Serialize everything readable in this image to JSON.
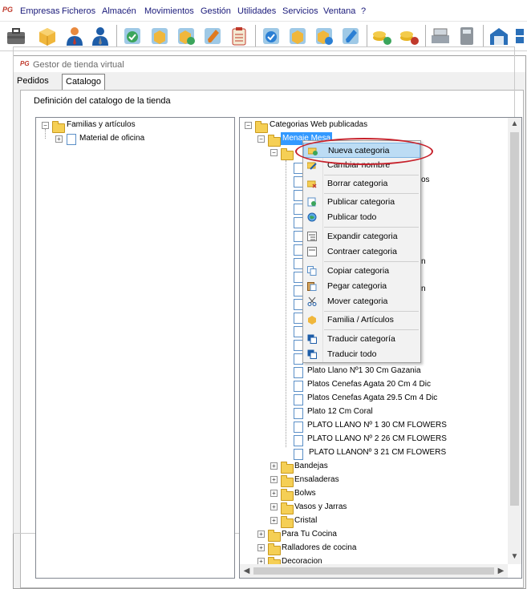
{
  "menubar": {
    "logo": "PG",
    "items": [
      "Empresas",
      "Ficheros",
      "Almacén",
      "Movimientos",
      "Gestión",
      "Utilidades",
      "Servicios",
      "Ventana",
      "?"
    ]
  },
  "toolbar": {
    "icons": [
      "briefcase-icon",
      "box-icon",
      "person-icon",
      "person-tie-icon",
      "check-icon",
      "box-yellow-icon",
      "box-check-icon",
      "pencil-icon",
      "clipboard-icon",
      "check-box-icon",
      "box-arrow-icon",
      "box-check2-icon",
      "pencil2-icon",
      "coins-add-icon",
      "coins-remove-icon",
      "cash-register-icon",
      "calculator-icon",
      "warehouse-icon",
      "grid-icon"
    ]
  },
  "window": {
    "logo": "PG",
    "title": "Gestor de tienda virtual",
    "tabs": [
      "Pedidos",
      "Catalogo"
    ],
    "active_tab": "Catalogo",
    "group_label": "Definición del catalogo de la tienda"
  },
  "left_tree": {
    "root": "Familias y artículos",
    "children": [
      "Material de oficina"
    ]
  },
  "right_tree": {
    "root": "Categorias Web publicadas",
    "selected": "Menaje Mesa",
    "partial_under_menu": [
      "os",
      "n",
      "n"
    ],
    "products": [
      "Plato Llano Nº1 30 Cm Gazania",
      "Platos Cenefas Agata 20 Cm 4 Dic",
      "Platos Cenefas Agata 29.5 Cm 4 Dic",
      "Plato 12 Cm Coral",
      "PLATO LLANO Nº 1 30 CM FLOWERS",
      "PLATO LLANO Nº 2 26 CM FLOWERS",
      "PLATO LLANONº 3 21 CM FLOWERS"
    ],
    "subcategories": [
      "Bandejas",
      "Ensaladeras",
      "Bolws",
      "Vasos y Jarras",
      "Cristal"
    ],
    "categories": [
      "Para Tu Cocina",
      "Ralladores de cocina",
      "Decoracion"
    ]
  },
  "context_menu": {
    "items": [
      {
        "label": "Nueva categoria",
        "icon": "folder-add-icon",
        "highlighted": true
      },
      {
        "label": "Cambiar nombre",
        "icon": "folder-edit-icon"
      },
      {
        "label": "Borrar categoria",
        "icon": "folder-delete-icon"
      },
      {
        "label": "Publicar categoria",
        "icon": "publish-icon"
      },
      {
        "label": "Publicar todo",
        "icon": "globe-icon"
      },
      {
        "label": "Expandir categoria",
        "icon": "expand-icon"
      },
      {
        "label": "Contraer categoria",
        "icon": "collapse-icon"
      },
      {
        "label": "Copiar categoria",
        "icon": "copy-icon"
      },
      {
        "label": "Pegar categoria",
        "icon": "paste-icon"
      },
      {
        "label": "Mover categoria",
        "icon": "scissors-icon"
      },
      {
        "label": "Familia / Artículos",
        "icon": "box-icon"
      },
      {
        "label": "Traducir categoría",
        "icon": "translate-icon"
      },
      {
        "label": "Traducir todo",
        "icon": "translate-all-icon"
      }
    ]
  },
  "colors": {
    "selection": "#3399ff",
    "menu_highlight": "#bcdcf4",
    "callout": "#c6202a",
    "folder": "#f5cf55"
  }
}
